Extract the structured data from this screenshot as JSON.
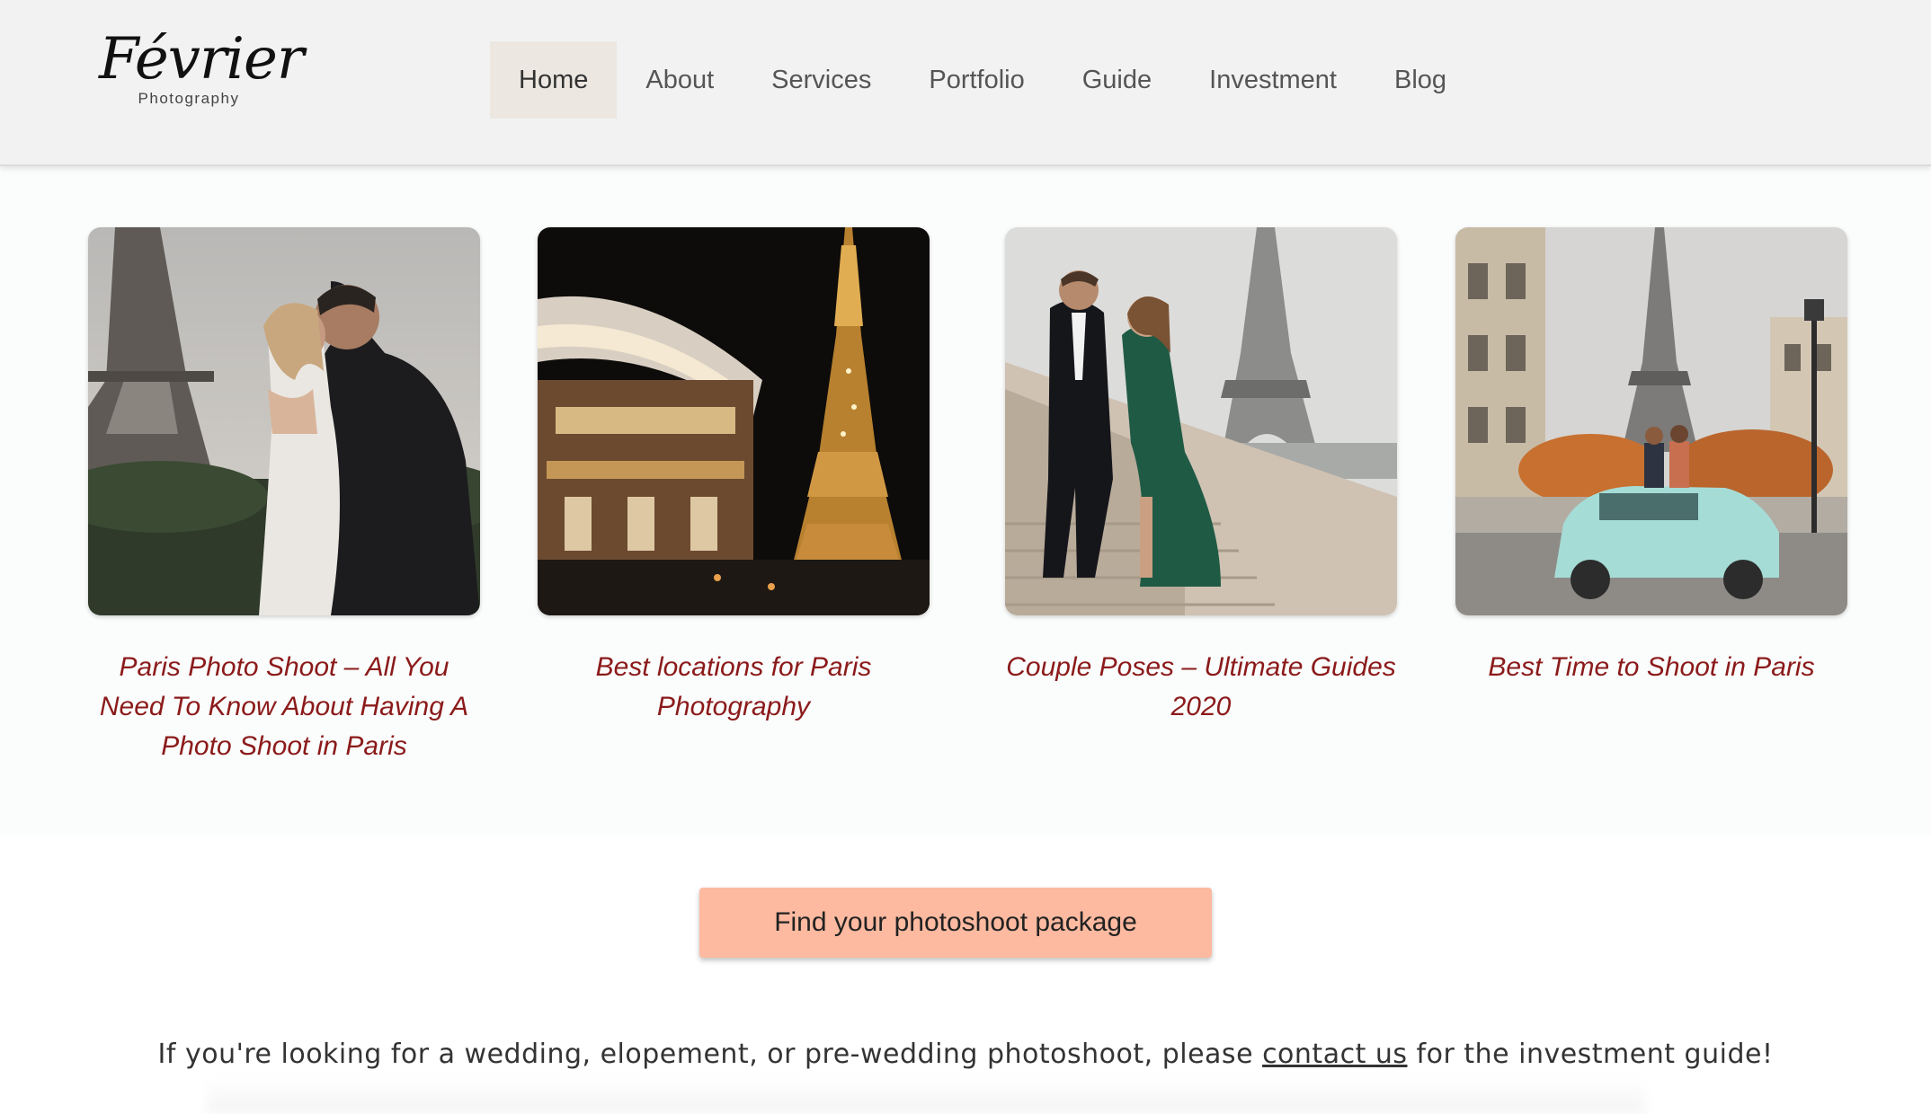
{
  "brand": {
    "name": "Février",
    "tagline": "Photography"
  },
  "nav": {
    "items": [
      {
        "label": "Home",
        "active": true
      },
      {
        "label": "About",
        "active": false
      },
      {
        "label": "Services",
        "active": false
      },
      {
        "label": "Portfolio",
        "active": false
      },
      {
        "label": "Guide",
        "active": false
      },
      {
        "label": "Investment",
        "active": false
      },
      {
        "label": "Blog",
        "active": false
      }
    ]
  },
  "blog_posts": [
    {
      "title": "Paris Photo Shoot – All You Need To Know About Having A Photo Shoot in Paris",
      "image": "couple-kissing-eiffel-tower-photo"
    },
    {
      "title": "Best locations for Paris Photography",
      "image": "carousel-eiffel-tower-night-photo"
    },
    {
      "title": "Couple Poses – Ultimate Guides 2020",
      "image": "couple-walking-stairs-eiffel-photo"
    },
    {
      "title": "Best Time to Shoot in Paris",
      "image": "couple-on-car-eiffel-street-photo"
    }
  ],
  "cta": {
    "label": "Find your photoshoot package"
  },
  "note": {
    "before": "If you're looking for a wedding, elopement, or pre-wedding photoshoot, please ",
    "link": "contact us",
    "after": " for the investment guide!"
  },
  "colors": {
    "header_bg": "#f2f2f2",
    "nav_active_bg": "#ece8e1",
    "title_color": "#8b1a1a",
    "cta_bg": "#fdbaa0"
  }
}
